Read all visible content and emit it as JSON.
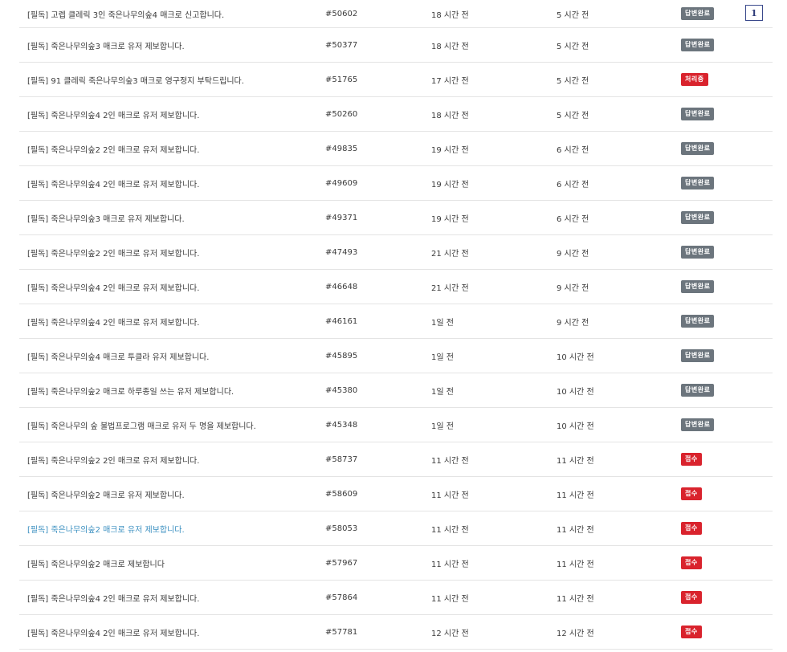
{
  "page_marker": "1",
  "status_colors": {
    "답변완료": "#6c757d",
    "처리중": "#d9232d",
    "접수": "#d9232d"
  },
  "rows": [
    {
      "title": "[필독] 고렙 클레릭 3인 죽은나무의숲4 매크로 신고합니다.",
      "id": "#50602",
      "created": "18 시간 전",
      "updated": "5 시간 전",
      "status": "답변완료"
    },
    {
      "title": "[필독] 죽은나무의숲3 매크로 유저 제보합니다.",
      "id": "#50377",
      "created": "18 시간 전",
      "updated": "5 시간 전",
      "status": "답변완료"
    },
    {
      "title": "[필독] 91 클레릭 죽은나무의숲3 매크로 영구정지 부탁드립니다.",
      "id": "#51765",
      "created": "17 시간 전",
      "updated": "5 시간 전",
      "status": "처리중"
    },
    {
      "title": "[필독] 죽은나무의숲4 2인 매크로 유저 제보합니다.",
      "id": "#50260",
      "created": "18 시간 전",
      "updated": "5 시간 전",
      "status": "답변완료"
    },
    {
      "title": "[필독] 죽은나무의숲2 2인 매크로 유저 제보합니다.",
      "id": "#49835",
      "created": "19 시간 전",
      "updated": "6 시간 전",
      "status": "답변완료"
    },
    {
      "title": "[필독] 죽은나무의숲4 2인 매크로 유저 제보합니다.",
      "id": "#49609",
      "created": "19 시간 전",
      "updated": "6 시간 전",
      "status": "답변완료"
    },
    {
      "title": "[필독] 죽은나무의숲3 매크로 유저 제보합니다.",
      "id": "#49371",
      "created": "19 시간 전",
      "updated": "6 시간 전",
      "status": "답변완료"
    },
    {
      "title": "[필독] 죽은나무의숲2 2인 매크로 유저 제보합니다.",
      "id": "#47493",
      "created": "21 시간 전",
      "updated": "9 시간 전",
      "status": "답변완료"
    },
    {
      "title": "[필독] 죽은나무의숲4 2인 매크로 유저 제보합니다.",
      "id": "#46648",
      "created": "21 시간 전",
      "updated": "9 시간 전",
      "status": "답변완료"
    },
    {
      "title": "[필독] 죽은나무의숲4 2인 매크로 유저 제보합니다.",
      "id": "#46161",
      "created": "1일 전",
      "updated": "9 시간 전",
      "status": "답변완료"
    },
    {
      "title": "[필독] 죽은나무의숲4 매크로 투클라 유저 제보합니다.",
      "id": "#45895",
      "created": "1일 전",
      "updated": "10 시간 전",
      "status": "답변완료"
    },
    {
      "title": "[필독] 죽은나무의숲2 매크로 하루종일 쓰는 유저 제보합니다.",
      "id": "#45380",
      "created": "1일 전",
      "updated": "10 시간 전",
      "status": "답변완료"
    },
    {
      "title": "[필독] 죽은나무의 숲 불법프로그램 매크로 유저 두 명을 제보합니다.",
      "id": "#45348",
      "created": "1일 전",
      "updated": "10 시간 전",
      "status": "답변완료"
    },
    {
      "title": "[필독] 죽은나무의숲2 2인 매크로 유저 제보합니다.",
      "id": "#58737",
      "created": "11 시간 전",
      "updated": "11 시간 전",
      "status": "접수"
    },
    {
      "title": "[필독] 죽은나무의숲2 매크로 유저 제보합니다.",
      "id": "#58609",
      "created": "11 시간 전",
      "updated": "11 시간 전",
      "status": "접수"
    },
    {
      "title": "[필독] 죽은나무의숲2 매크로 유저 제보합니다.",
      "id": "#58053",
      "created": "11 시간 전",
      "updated": "11 시간 전",
      "status": "접수"
    },
    {
      "title": "[필독] 죽은나무의숲2 매크로 제보합니다",
      "id": "#57967",
      "created": "11 시간 전",
      "updated": "11 시간 전",
      "status": "접수"
    },
    {
      "title": "[필독] 죽은나무의숲4 2인 매크로 유저 제보합니다.",
      "id": "#57864",
      "created": "11 시간 전",
      "updated": "11 시간 전",
      "status": "접수"
    },
    {
      "title": "[필독] 죽은나무의숲4 2인 매크로 유저 제보합니다.",
      "id": "#57781",
      "created": "12 시간 전",
      "updated": "12 시간 전",
      "status": "접수"
    }
  ]
}
